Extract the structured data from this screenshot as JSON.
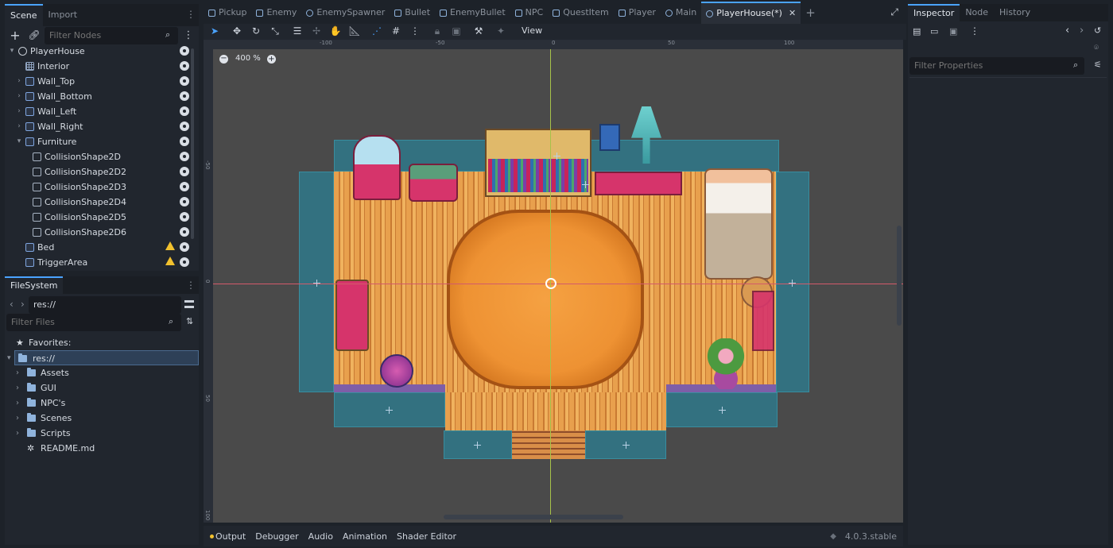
{
  "scene_dock": {
    "tabs": [
      "Scene",
      "Import"
    ],
    "filter_placeholder": "Filter Nodes",
    "nodes": [
      {
        "label": "PlayerHouse",
        "depth": 0,
        "arrow": "▾",
        "icon": "circle",
        "warning": false
      },
      {
        "label": "Interior",
        "depth": 1,
        "arrow": "",
        "icon": "grid",
        "warning": false
      },
      {
        "label": "Wall_Top",
        "depth": 1,
        "arrow": "›",
        "icon": "shape",
        "warning": false
      },
      {
        "label": "Wall_Bottom",
        "depth": 1,
        "arrow": "›",
        "icon": "shape",
        "warning": false
      },
      {
        "label": "Wall_Left",
        "depth": 1,
        "arrow": "›",
        "icon": "shape",
        "warning": false
      },
      {
        "label": "Wall_Right",
        "depth": 1,
        "arrow": "›",
        "icon": "shape",
        "warning": false
      },
      {
        "label": "Furniture",
        "depth": 1,
        "arrow": "▾",
        "icon": "shape",
        "warning": false
      },
      {
        "label": "CollisionShape2D",
        "depth": 2,
        "arrow": "",
        "icon": "square",
        "warning": false
      },
      {
        "label": "CollisionShape2D2",
        "depth": 2,
        "arrow": "",
        "icon": "square",
        "warning": false
      },
      {
        "label": "CollisionShape2D3",
        "depth": 2,
        "arrow": "",
        "icon": "square",
        "warning": false
      },
      {
        "label": "CollisionShape2D4",
        "depth": 2,
        "arrow": "",
        "icon": "square",
        "warning": false
      },
      {
        "label": "CollisionShape2D5",
        "depth": 2,
        "arrow": "",
        "icon": "square",
        "warning": false
      },
      {
        "label": "CollisionShape2D6",
        "depth": 2,
        "arrow": "",
        "icon": "square",
        "warning": false
      },
      {
        "label": "Bed",
        "depth": 1,
        "arrow": "",
        "icon": "shape",
        "warning": true
      },
      {
        "label": "TriggerArea",
        "depth": 1,
        "arrow": "",
        "icon": "shape",
        "warning": true
      }
    ]
  },
  "filesystem": {
    "tab": "FileSystem",
    "path": "res://",
    "filter_placeholder": "Filter Files",
    "favorites_label": "Favorites:",
    "root": "res://",
    "items": [
      {
        "label": "Assets",
        "type": "folder"
      },
      {
        "label": "GUI",
        "type": "folder"
      },
      {
        "label": "NPC's",
        "type": "folder"
      },
      {
        "label": "Scenes",
        "type": "folder"
      },
      {
        "label": "Scripts",
        "type": "folder"
      },
      {
        "label": "README.md",
        "type": "file"
      }
    ]
  },
  "editor_tabs": [
    {
      "label": "Pickup",
      "icon": "sq",
      "active": false
    },
    {
      "label": "Enemy",
      "icon": "sq",
      "active": false
    },
    {
      "label": "EnemySpawner",
      "icon": "circle",
      "active": false
    },
    {
      "label": "Bullet",
      "icon": "sq",
      "active": false
    },
    {
      "label": "EnemyBullet",
      "icon": "sq",
      "active": false
    },
    {
      "label": "NPC",
      "icon": "sq",
      "active": false
    },
    {
      "label": "QuestItem",
      "icon": "sq",
      "active": false
    },
    {
      "label": "Player",
      "icon": "sq",
      "active": false
    },
    {
      "label": "Main",
      "icon": "circle",
      "active": false
    },
    {
      "label": "PlayerHouse(*)",
      "icon": "circle",
      "active": true
    }
  ],
  "toolbar": {
    "view_label": "View"
  },
  "viewport": {
    "zoom_label": "400 %",
    "ruler_top": [
      "-100",
      "-50",
      "0",
      "50",
      "100"
    ],
    "ruler_left": [
      "-50",
      "0",
      "50",
      "100"
    ]
  },
  "inspector": {
    "tabs": [
      "Inspector",
      "Node",
      "History"
    ],
    "filter_placeholder": "Filter Properties"
  },
  "bottom_bar": {
    "tabs": [
      "Output",
      "Debugger",
      "Audio",
      "Animation",
      "Shader Editor"
    ],
    "version": "4.0.3.stable"
  },
  "colors": {
    "accent": "#4aa3ff",
    "warning": "#f2c12e",
    "collision_teal": "#2f788a",
    "floor": "#e8a04d"
  }
}
